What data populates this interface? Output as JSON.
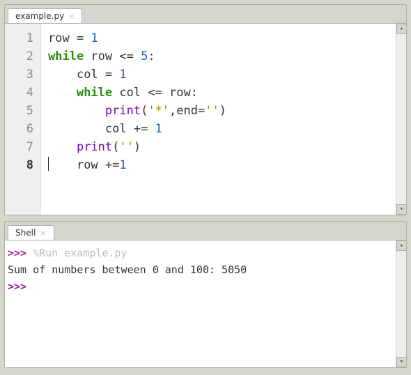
{
  "editor": {
    "tab_label": "example.py",
    "tab_close_glyph": "×",
    "line_numbers": [
      "1",
      "2",
      "3",
      "4",
      "5",
      "6",
      "7",
      "8"
    ],
    "current_line_index": 7,
    "code": {
      "l1": {
        "a": "row = ",
        "num": "1"
      },
      "l2": {
        "kw": "while",
        "a": " row <= ",
        "num": "5",
        "b": ":"
      },
      "l3": {
        "indent": "    ",
        "a": "col = ",
        "num": "1"
      },
      "l4": {
        "indent": "    ",
        "kw": "while",
        "a": " col <= row:"
      },
      "l5": {
        "indent": "        ",
        "fn": "print",
        "a": "(",
        "s1": "'*'",
        "b": ",end=",
        "s2": "''",
        "c": ")"
      },
      "l6": {
        "indent": "        ",
        "a": "col += ",
        "num": "1"
      },
      "l7": {
        "indent": "    ",
        "fn": "print",
        "a": "(",
        "s1": "''",
        "b": ")"
      },
      "l8": {
        "indent": "    ",
        "a": "row +=",
        "num": "1"
      }
    }
  },
  "shell": {
    "tab_label": "Shell",
    "tab_close_glyph": "×",
    "prompt": ">>>",
    "run_cmd": "%Run example.py",
    "output": " Sum of numbers between 0 and 100: 5050"
  },
  "scrollbar": {
    "up": "▴",
    "down": "▾"
  }
}
